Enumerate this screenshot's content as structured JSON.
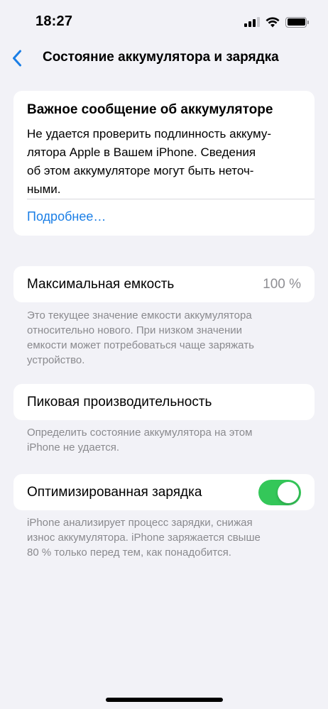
{
  "status_bar": {
    "time": "18:27",
    "icons": [
      "cellular-signal-icon",
      "wifi-icon",
      "battery-icon"
    ]
  },
  "nav": {
    "back_icon": "chevron-left-icon",
    "title": "Состояние аккумулятора и зарядка"
  },
  "alert": {
    "title": "Важное сообщение об аккумуляторе",
    "body_lines": [
      "Не удается проверить подлинность аккуму-",
      "лятора Apple в Вашем iPhone. Сведения",
      "об этом аккумуляторе могут быть неточ-",
      "ными."
    ],
    "link": "Подробнее…"
  },
  "max_capacity": {
    "label": "Максимальная емкость",
    "value": "100 %",
    "footnote_lines": [
      "Это текущее значение емкости аккумулятора",
      "относительно нового. При низком значении",
      "емкости может потребоваться чаще заряжать",
      "устройство."
    ]
  },
  "peak_performance": {
    "label": "Пиковая производительность",
    "footnote_lines": [
      "Определить состояние аккумулятора на этом",
      "iPhone не удается."
    ]
  },
  "optimized_charging": {
    "label": "Оптимизированная зарядка",
    "enabled": true,
    "footnote_lines": [
      "iPhone анализирует процесс зарядки, снижая",
      "износ аккумулятора. iPhone заряжается свыше",
      "80 % только перед тем, как понадобится."
    ]
  },
  "colors": {
    "background": "#f2f2f7",
    "accent": "#1a7ee6",
    "toggle_on": "#34c759",
    "secondary_text": "#8a8a8e"
  }
}
